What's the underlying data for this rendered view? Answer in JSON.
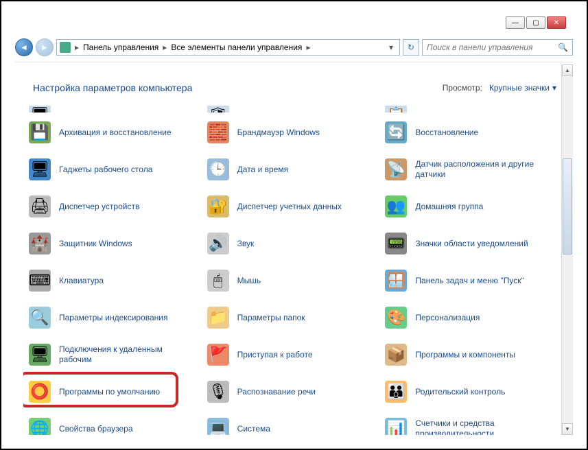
{
  "titlebar": {
    "min": "—",
    "max": "▢",
    "close": "✕"
  },
  "nav": {
    "back": "◄",
    "fwd": "►"
  },
  "breadcrumbs": [
    {
      "label": "Панель управления"
    },
    {
      "label": "Все элементы панели управления"
    }
  ],
  "addr_drop": "▾",
  "refresh": "↻",
  "search": {
    "placeholder": "Поиск в панели управления",
    "icon": "🔍"
  },
  "header": {
    "title": "Настройка параметров компьютера",
    "view_label": "Просмотр:",
    "view_value": "Крупные значки",
    "view_caret": "▾"
  },
  "items": [
    {
      "label": "",
      "ico": "🖥",
      "bg": "#cde"
    },
    {
      "label": "",
      "ico": "🛡",
      "bg": "#cde"
    },
    {
      "label": "",
      "ico": "📋",
      "bg": "#cde"
    },
    {
      "label": "Архивация и восстановление",
      "ico": "💾",
      "bg": "#7a5"
    },
    {
      "label": "Брандмауэр Windows",
      "ico": "🧱",
      "bg": "#d86"
    },
    {
      "label": "Восстановление",
      "ico": "🔄",
      "bg": "#6ac"
    },
    {
      "label": "Гаджеты рабочего стола",
      "ico": "🖥",
      "bg": "#48c"
    },
    {
      "label": "Дата и время",
      "ico": "🕒",
      "bg": "#9bd"
    },
    {
      "label": "Датчик расположения и другие датчики",
      "ico": "📡",
      "bg": "#c96"
    },
    {
      "label": "Диспетчер устройств",
      "ico": "🖨",
      "bg": "#bbb"
    },
    {
      "label": "Диспетчер учетных данных",
      "ico": "🔐",
      "bg": "#db6"
    },
    {
      "label": "Домашняя группа",
      "ico": "👥",
      "bg": "#6c6"
    },
    {
      "label": "Защитник Windows",
      "ico": "🏰",
      "bg": "#999"
    },
    {
      "label": "Звук",
      "ico": "🔊",
      "bg": "#ccc"
    },
    {
      "label": "Значки области уведомлений",
      "ico": "📟",
      "bg": "#888"
    },
    {
      "label": "Клавиатура",
      "ico": "⌨",
      "bg": "#aaa"
    },
    {
      "label": "Мышь",
      "ico": "🖱",
      "bg": "#ccc"
    },
    {
      "label": "Панель задач и меню ''Пуск''",
      "ico": "🪟",
      "bg": "#6ad"
    },
    {
      "label": "Параметры индексирования",
      "ico": "🔍",
      "bg": "#9cd"
    },
    {
      "label": "Параметры папок",
      "ico": "📁",
      "bg": "#ec8"
    },
    {
      "label": "Персонализация",
      "ico": "🎨",
      "bg": "#6c8"
    },
    {
      "label": "Подключения к удаленным рабочим",
      "ico": "🖥",
      "bg": "#6a6"
    },
    {
      "label": "Приступая к работе",
      "ico": "🚩",
      "bg": "#e86"
    },
    {
      "label": "Программы и компоненты",
      "ico": "📦",
      "bg": "#db8"
    },
    {
      "label": "Программы по умолчанию",
      "ico": "⭕",
      "bg": "#fc4"
    },
    {
      "label": "Распознавание речи",
      "ico": "🎙",
      "bg": "#bbb"
    },
    {
      "label": "Родительский контроль",
      "ico": "👪",
      "bg": "#fb6"
    },
    {
      "label": "Свойства браузера",
      "ico": "🌐",
      "bg": "#7c7"
    },
    {
      "label": "Система",
      "ico": "💻",
      "bg": "#8bd"
    },
    {
      "label": "Счетчики и средства производительности",
      "ico": "📊",
      "bg": "#7bd"
    }
  ],
  "highlight_index": 24
}
